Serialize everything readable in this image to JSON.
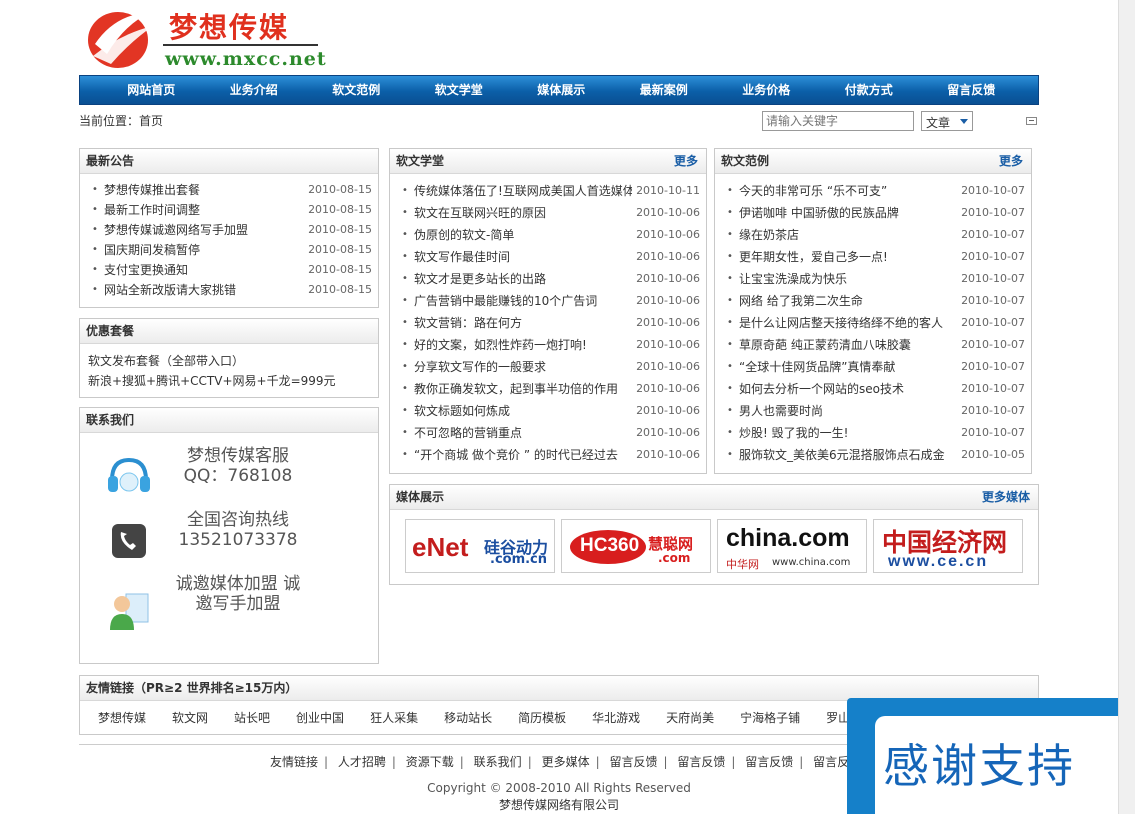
{
  "logo": {
    "name_cn": "梦想传媒",
    "url": "www.mxcc.net"
  },
  "nav": [
    "网站首页",
    "业务介绍",
    "软文范例",
    "软文学堂",
    "媒体展示",
    "最新案例",
    "业务价格",
    "付款方式",
    "留言反馈"
  ],
  "breadcrumb": "当前位置：首页",
  "search": {
    "placeholder": "请输入关键字",
    "select_value": "文章"
  },
  "notice": {
    "title": "最新公告",
    "items": [
      {
        "t": "梦想传媒推出套餐",
        "d": "2010-08-15"
      },
      {
        "t": "最新工作时间调整",
        "d": "2010-08-15"
      },
      {
        "t": "梦想传媒诚邀网络写手加盟",
        "d": "2010-08-15"
      },
      {
        "t": "国庆期间发稿暂停",
        "d": "2010-08-15"
      },
      {
        "t": "支付宝更换通知",
        "d": "2010-08-15"
      },
      {
        "t": "网站全新改版请大家挑错",
        "d": "2010-08-15"
      }
    ]
  },
  "offer": {
    "title": "优惠套餐",
    "line1": "软文发布套餐（全部带入口）",
    "line2": "新浪+搜狐+腾讯+CCTV+网易+千龙=999元"
  },
  "contact": {
    "title": "联系我们",
    "rows": [
      {
        "icon": "headset-icon",
        "text": "梦想传媒客服 QQ：768108"
      },
      {
        "icon": "phone-icon",
        "text": "全国咨询热线 13521073378"
      },
      {
        "icon": "person-icon",
        "text": "诚邀媒体加盟 诚邀写手加盟"
      }
    ]
  },
  "school": {
    "title": "软文学堂",
    "more": "更多",
    "items": [
      {
        "t": "传统媒体落伍了!互联网成美国人首选媒体",
        "d": "2010-10-11"
      },
      {
        "t": "软文在互联网兴旺的原因",
        "d": "2010-10-06"
      },
      {
        "t": "伪原创的软文-简单",
        "d": "2010-10-06"
      },
      {
        "t": "软文写作最佳时间",
        "d": "2010-10-06"
      },
      {
        "t": "软文才是更多站长的出路",
        "d": "2010-10-06"
      },
      {
        "t": "广告营销中最能赚钱的10个广告词",
        "d": "2010-10-06"
      },
      {
        "t": "软文营销：路在何方",
        "d": "2010-10-06"
      },
      {
        "t": "好的文案，如烈性炸药一炮打响!",
        "d": "2010-10-06"
      },
      {
        "t": "分享软文写作的一般要求",
        "d": "2010-10-06"
      },
      {
        "t": "教你正确发软文，起到事半功倍的作用",
        "d": "2010-10-06"
      },
      {
        "t": "软文标题如何炼成",
        "d": "2010-10-06"
      },
      {
        "t": "不可忽略的营销重点",
        "d": "2010-10-06"
      },
      {
        "t": "“开个商城 做个竞价 ” 的时代已经过去",
        "d": "2010-10-06"
      }
    ]
  },
  "cases": {
    "title": "软文范例",
    "more": "更多",
    "items": [
      {
        "t": "今天的非常可乐 “乐不可支”",
        "d": "2010-10-07"
      },
      {
        "t": "伊诺咖啡 中国骄傲的民族品牌",
        "d": "2010-10-07"
      },
      {
        "t": "缘在奶茶店",
        "d": "2010-10-07"
      },
      {
        "t": "更年期女性，爱自己多一点!",
        "d": "2010-10-07"
      },
      {
        "t": "让宝宝洗澡成为快乐",
        "d": "2010-10-07"
      },
      {
        "t": "网络 给了我第二次生命",
        "d": "2010-10-07"
      },
      {
        "t": "是什么让网店整天接待络绎不绝的客人",
        "d": "2010-10-07"
      },
      {
        "t": "草原奇葩 纯正蒙药清血八味胶囊",
        "d": "2010-10-07"
      },
      {
        "t": "“全球十佳网货品牌”真情奉献",
        "d": "2010-10-07"
      },
      {
        "t": "如何去分析一个网站的seo技术",
        "d": "2010-10-07"
      },
      {
        "t": "男人也需要时尚",
        "d": "2010-10-07"
      },
      {
        "t": "炒股! 毁了我的一生!",
        "d": "2010-10-07"
      },
      {
        "t": "服饰软文_美依美6元混搭服饰点石成金",
        "d": "2010-10-05"
      }
    ]
  },
  "media": {
    "title": "媒体展示",
    "more": "更多媒体",
    "logos": [
      {
        "a": "eNet",
        "b": "硅谷动力",
        "c": ".com.cn"
      },
      {
        "a": "HC360",
        "b": "慧聪网",
        "c": ".com"
      },
      {
        "a": "china.com",
        "b": "中华网",
        "c": "www.china.com"
      },
      {
        "a": "中国经济网",
        "b": "www.ce.cn",
        "c": ""
      }
    ]
  },
  "links": {
    "title": "友情链接（PR≥2 世界排名≥15万内）",
    "items": [
      "梦想传媒",
      "软文网",
      "站长吧",
      "创业中国",
      "狂人采集",
      "移动站长",
      "简历模板",
      "华北游戏",
      "天府尚美",
      "宁海格子铺",
      "罗山"
    ]
  },
  "footer": {
    "nav": [
      "友情链接",
      "人才招聘",
      "资源下载",
      "联系我们",
      "更多媒体",
      "留言反馈",
      "留言反馈",
      "留言反馈",
      "留言反馈"
    ],
    "copyright": "Copyright © 2008-2010 All Rights Reserved",
    "company": "梦想传媒网络有限公司"
  },
  "thanks": "感谢支持",
  "colors": {
    "nav": "#0b5fa8",
    "logo_red": "#e0301e",
    "logo_green": "#2c8a2c",
    "more": "#1a5ea6"
  }
}
